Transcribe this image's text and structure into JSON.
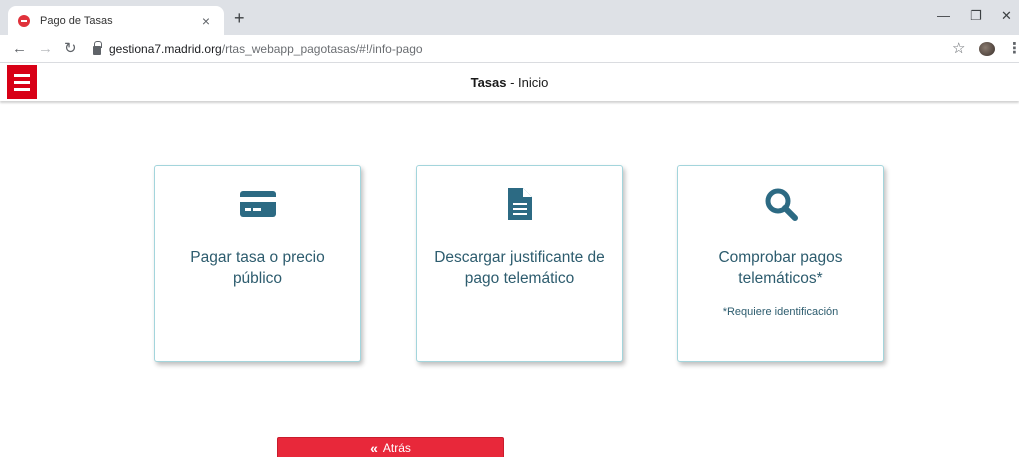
{
  "browser": {
    "tab_title": "Pago de Tasas",
    "tab_close": "×",
    "new_tab": "+",
    "url_host": "gestiona7.madrid.org",
    "url_path": "/rtas_webapp_pagotasas/#!/info-pago"
  },
  "header": {
    "title_bold": "Tasas",
    "title_rest": " - Inicio"
  },
  "cards": [
    {
      "icon": "credit-card-icon",
      "label": "Pagar tasa o precio público",
      "note": ""
    },
    {
      "icon": "document-icon",
      "label": "Descargar justificante de pago telemático",
      "note": ""
    },
    {
      "icon": "search-icon",
      "label": "Comprobar pagos telemáticos*",
      "note": "*Requiere identificación"
    }
  ],
  "back_button": {
    "label": "Atrás",
    "icon": "double-chevron-left-icon"
  },
  "colors": {
    "accent_red": "#d80016",
    "button_red": "#e8283a",
    "card_text": "#2d5c6e",
    "icon_blue": "#2c6a83",
    "card_border": "#a3d5dc"
  }
}
